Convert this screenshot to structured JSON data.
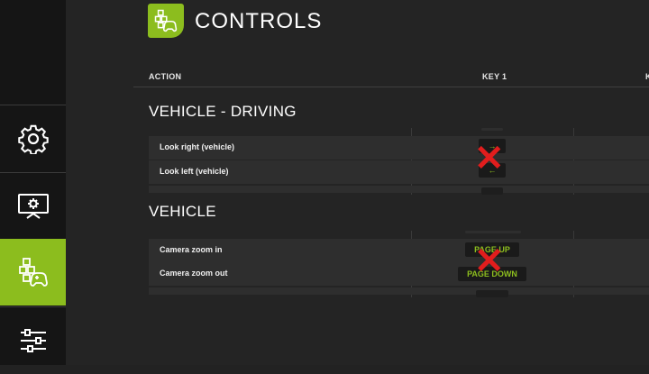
{
  "page": {
    "title": "CONTROLS"
  },
  "table": {
    "col_action": "ACTION",
    "col_key1": "KEY 1",
    "col_key2_partial": "K"
  },
  "sections": [
    {
      "title": "VEHICLE - DRIVING",
      "rows": [
        {
          "label": "Look right (vehicle)",
          "key1": "→"
        },
        {
          "label": "Look left (vehicle)",
          "key1": "←"
        }
      ]
    },
    {
      "title": "VEHICLE",
      "rows": [
        {
          "label": "Camera zoom in",
          "key1": "PAGE UP"
        },
        {
          "label": "Camera zoom out",
          "key1": "PAGE DOWN"
        }
      ]
    }
  ],
  "overlay": {
    "mark": "✕"
  },
  "sidebar": {
    "items": [
      {
        "icon": "gear-icon"
      },
      {
        "icon": "display-settings-icon"
      },
      {
        "icon": "controls-gamepad-icon",
        "active": true
      },
      {
        "icon": "sliders-icon"
      }
    ]
  },
  "colors": {
    "accent": "#8cbd1e",
    "background": "#242424",
    "sidebar": "#151515",
    "mark": "#e11d1d"
  }
}
